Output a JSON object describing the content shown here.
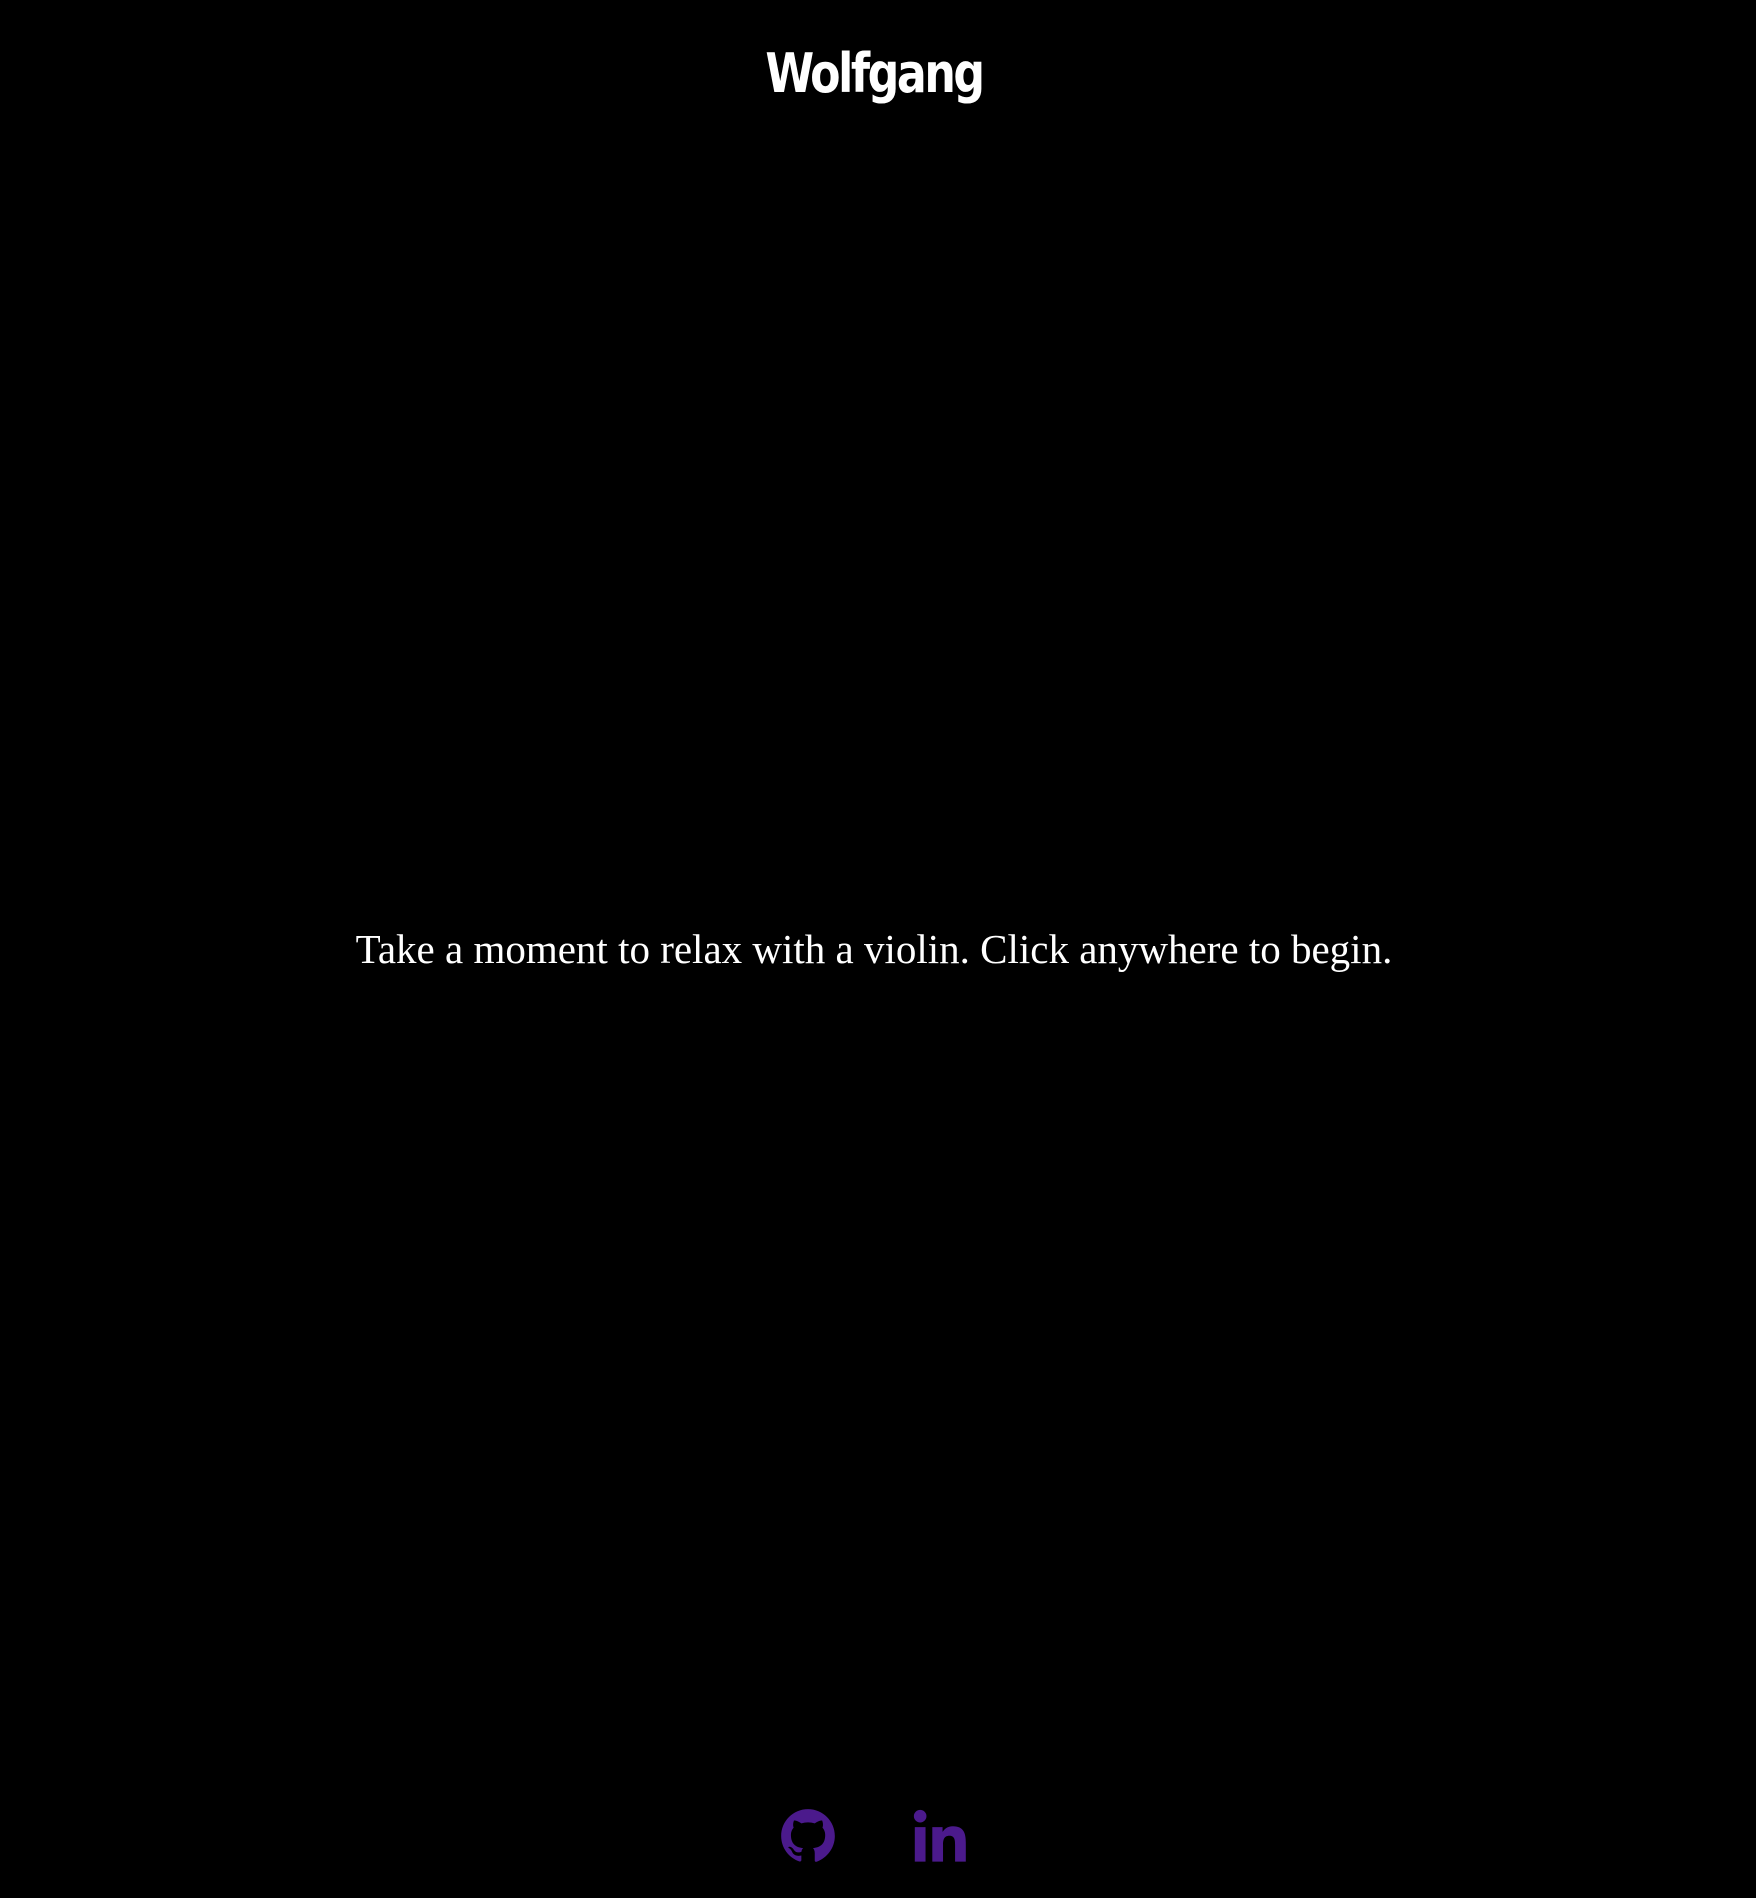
{
  "app": {
    "title": "Wolfgang"
  },
  "main": {
    "prompt": "Take a moment to relax with a violin. Click anywhere to begin."
  },
  "footer": {
    "links": [
      {
        "icon": "github-icon"
      },
      {
        "icon": "linkedin-icon"
      }
    ]
  },
  "colors": {
    "background": "#000000",
    "text": "#ffffff",
    "icon_accent": "#4b1a8c"
  }
}
